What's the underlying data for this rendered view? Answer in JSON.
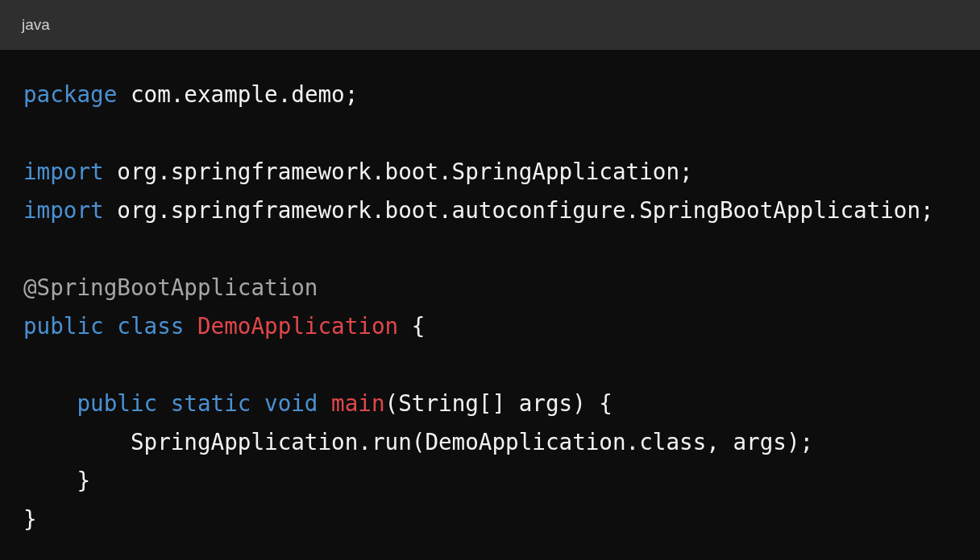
{
  "header": {
    "language": "java"
  },
  "code_lines": [
    {
      "kind": "code",
      "tokens": [
        {
          "kind": "keyword",
          "text": "package"
        },
        {
          "kind": "plain",
          "text": " com.example.demo;"
        }
      ]
    },
    {
      "kind": "blank"
    },
    {
      "kind": "code",
      "tokens": [
        {
          "kind": "keyword",
          "text": "import"
        },
        {
          "kind": "plain",
          "text": " org.springframework.boot.SpringApplication;"
        }
      ]
    },
    {
      "kind": "code",
      "tokens": [
        {
          "kind": "keyword",
          "text": "import"
        },
        {
          "kind": "plain",
          "text": " org.springframework.boot.autoconfigure.SpringBootApplication;"
        }
      ]
    },
    {
      "kind": "blank"
    },
    {
      "kind": "code",
      "tokens": [
        {
          "kind": "annotation",
          "text": "@SpringBootApplication"
        }
      ]
    },
    {
      "kind": "code",
      "tokens": [
        {
          "kind": "keyword",
          "text": "public class"
        },
        {
          "kind": "name",
          "text": " DemoApplication"
        },
        {
          "kind": "plain",
          "text": " {"
        }
      ]
    },
    {
      "kind": "blank"
    },
    {
      "kind": "code",
      "tokens": [
        {
          "kind": "keyword",
          "text": "    public static void"
        },
        {
          "kind": "name",
          "text": " main"
        },
        {
          "kind": "plain",
          "text": "(String[] args) {"
        }
      ]
    },
    {
      "kind": "code",
      "tokens": [
        {
          "kind": "plain",
          "text": "        SpringApplication.run(DemoApplication.class, args);"
        }
      ]
    },
    {
      "kind": "code",
      "tokens": [
        {
          "kind": "plain",
          "text": "    }"
        }
      ]
    },
    {
      "kind": "code",
      "tokens": [
        {
          "kind": "plain",
          "text": "}"
        }
      ]
    }
  ]
}
